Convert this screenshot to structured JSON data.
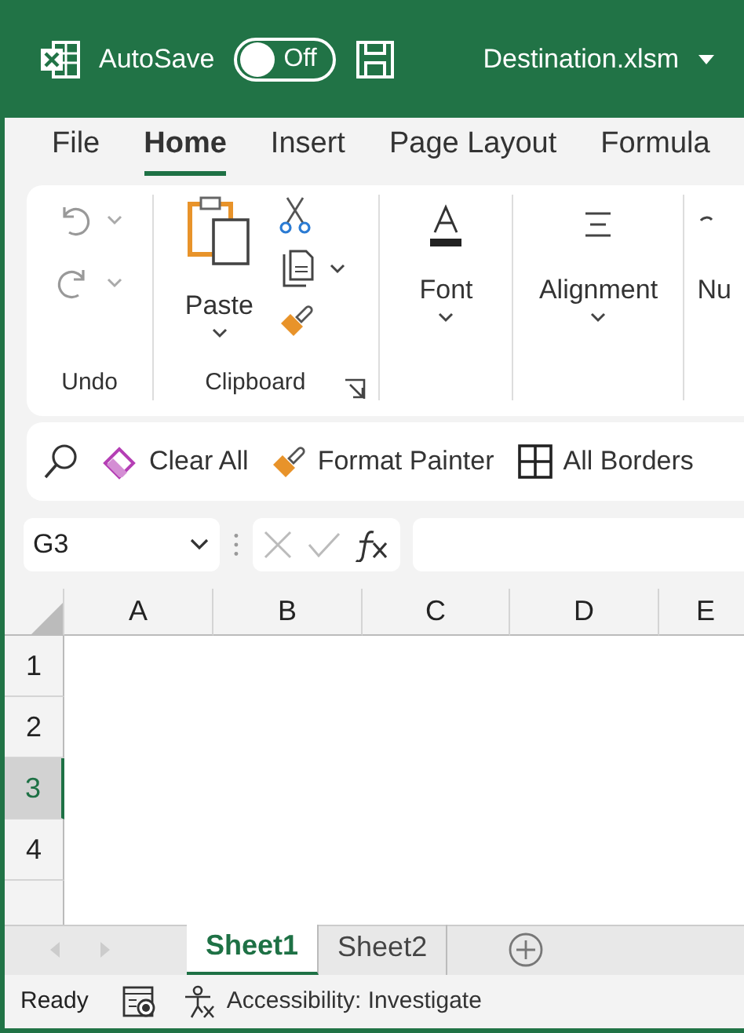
{
  "title_bar": {
    "autosave_label": "AutoSave",
    "autosave": {
      "on": false,
      "label": "Off"
    },
    "filename": "Destination.xlsm"
  },
  "tabs": [
    {
      "label": "File",
      "selected": false
    },
    {
      "label": "Home",
      "selected": true
    },
    {
      "label": "Insert",
      "selected": false
    },
    {
      "label": "Page Layout",
      "selected": false
    },
    {
      "label": "Formula",
      "selected": false
    }
  ],
  "ribbon_groups": [
    {
      "kind": "undo",
      "label": "Undo"
    },
    {
      "kind": "clipboard",
      "label": "Clipboard",
      "paste": "Paste"
    },
    {
      "kind": "font",
      "label": "Font"
    },
    {
      "kind": "align",
      "label": "Alignment"
    },
    {
      "kind": "number",
      "label": "Nu"
    }
  ],
  "quick_bar": [
    {
      "kind": "eraser",
      "label": "Clear All"
    },
    {
      "kind": "brush",
      "label": "Format Painter"
    },
    {
      "kind": "borders",
      "label": "All Borders"
    }
  ],
  "name_box": "G3",
  "columns": [
    "A",
    "B",
    "C",
    "D",
    "E"
  ],
  "rows": [
    {
      "label": "1",
      "selected": false
    },
    {
      "label": "2",
      "selected": false
    },
    {
      "label": "3",
      "selected": true
    },
    {
      "label": "4",
      "selected": false
    }
  ],
  "sheets": [
    {
      "label": "Sheet1",
      "selected": true
    },
    {
      "label": "Sheet2",
      "selected": false
    }
  ],
  "status_bar": {
    "ready": "Ready",
    "accessibility": "Accessibility: Investigate"
  }
}
